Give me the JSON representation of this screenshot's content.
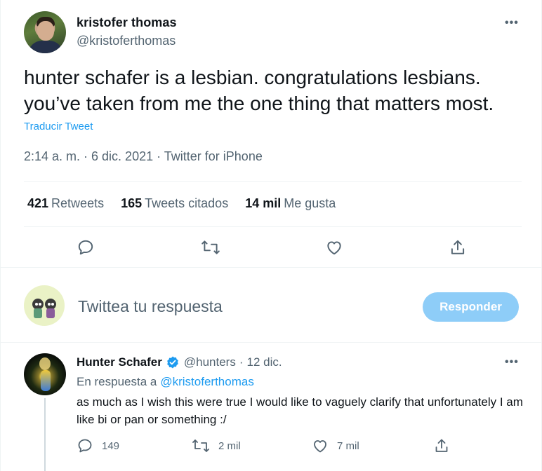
{
  "main_tweet": {
    "author_name": "kristofer thomas",
    "author_handle": "@kristoferthomas",
    "more_label": "•••",
    "text": "hunter schafer is a lesbian. congratulations lesbians. you’ve taken from me the one thing that matters most.",
    "translate_label": "Traducir Tweet",
    "timestamp": "2:14 a. m. · 6 dic. 2021 · Twitter for iPhone",
    "stats": {
      "retweets_count": "421",
      "retweets_label": "Retweets",
      "quotes_count": "165",
      "quotes_label": "Tweets citados",
      "likes_count": "14 mil",
      "likes_label": "Me gusta"
    }
  },
  "reply_composer": {
    "placeholder": "Twittea tu respuesta",
    "button_label": "Responder"
  },
  "reply_tweet": {
    "author_name": "Hunter Schafer",
    "author_handle": "@hunters",
    "separator": "·",
    "date": "12 dic.",
    "more_label": "•••",
    "in_reply_prefix": "En respuesta a",
    "in_reply_mention": "@kristoferthomas",
    "text": "as much as I wish this were true I would like to vaguely clarify that unfortunately I am like bi or pan or something :/",
    "actions": {
      "replies": "149",
      "retweets": "2 mil",
      "likes": "7 mil"
    }
  },
  "icons": [
    "reply-icon",
    "retweet-icon",
    "like-icon",
    "share-icon",
    "verified-icon",
    "more-icon"
  ],
  "colors": {
    "accent": "#1d9bf0",
    "button_disabled": "#8ecdf8",
    "secondary_text": "#536471",
    "primary_text": "#0f1419",
    "divider": "#eff3f4"
  }
}
